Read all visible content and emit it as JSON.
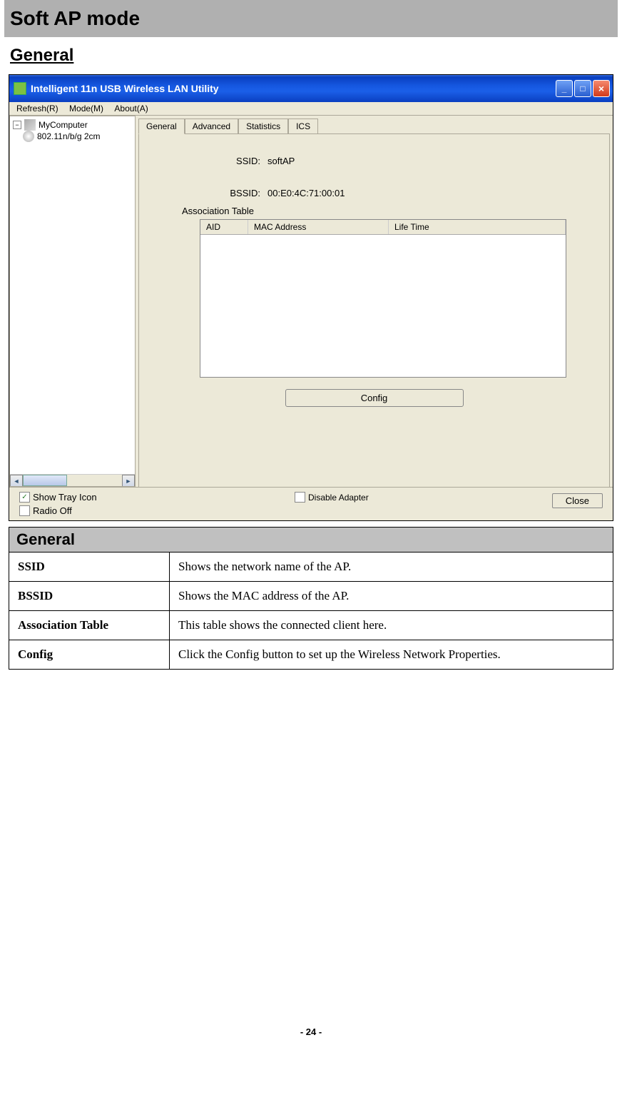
{
  "doc": {
    "chapter_title": "Soft AP mode",
    "section_title": "General",
    "page_number": "- 24 -"
  },
  "win": {
    "title": "Intelligent 11n USB Wireless LAN Utility",
    "menu": {
      "refresh": "Refresh(R)",
      "mode": "Mode(M)",
      "about": "About(A)"
    },
    "tree": {
      "root": "MyComputer",
      "child": "802.11n/b/g 2cm"
    },
    "tabs": {
      "general": "General",
      "advanced": "Advanced",
      "statistics": "Statistics",
      "ics": "ICS"
    },
    "fields": {
      "ssid_label": "SSID:",
      "ssid_value": "softAP",
      "bssid_label": "BSSID:",
      "bssid_value": "00:E0:4C:71:00:01",
      "assoc_label": "Association Table"
    },
    "cols": {
      "aid": "AID",
      "mac": "MAC Address",
      "life": "Life Time"
    },
    "buttons": {
      "config": "Config",
      "close": "Close"
    },
    "checks": {
      "tray": "Show Tray Icon",
      "radio": "Radio Off",
      "disable": "Disable Adapter"
    }
  },
  "table": {
    "header": "General",
    "rows": [
      {
        "key": "SSID",
        "val": "Shows the network name of the AP."
      },
      {
        "key": "BSSID",
        "val": "Shows the MAC address of the AP."
      },
      {
        "key": "Association Table",
        "val": "This table shows the connected client here."
      },
      {
        "key": "Config",
        "val": "Click the Config button to set up the Wireless Network Properties."
      }
    ]
  }
}
